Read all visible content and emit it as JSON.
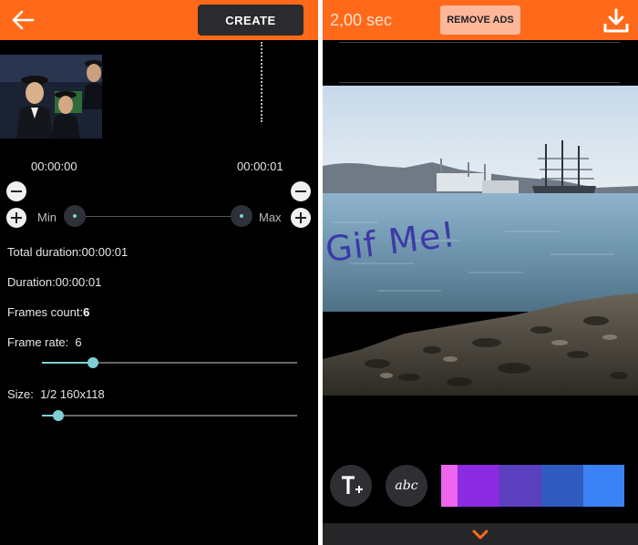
{
  "left_screen": {
    "topbar": {
      "create_label": "CREATE",
      "back_icon": "arrow-left-icon"
    },
    "timeline": {
      "start_time": "00:00:00",
      "end_time": "00:00:01"
    },
    "range": {
      "min_label": "Min",
      "max_label": "Max"
    },
    "info": {
      "total_duration": "Total duration:00:00:01",
      "duration": "Duration:00:00:01",
      "frames_label": "Frames count:",
      "frames_value": "6",
      "frame_rate_label": "Frame rate:",
      "frame_rate_value": "6",
      "size_label": "Size:",
      "size_value": "1/2 160x118"
    },
    "sliders": {
      "frame_rate_fraction": 0.2,
      "size_fraction": 0.065
    }
  },
  "right_screen": {
    "topbar": {
      "duration": "2,00 sec",
      "remove_ads_label": "REMOVE ADS",
      "download_icon": "download-icon"
    },
    "overlay_text": "Gif Me!",
    "tools": {
      "text_icon": "text-add-icon",
      "font_icon": "font-style-icon",
      "font_glyph": "abc"
    },
    "palette": [
      "#ee66ee",
      "#8b2be2",
      "#5a3fbe",
      "#2f5ac0",
      "#3b82f6"
    ],
    "expand_icon": "chevron-down-icon"
  },
  "colors": {
    "accent": "#ff6a1a",
    "slider": "#7fd0d6",
    "background": "#000000"
  }
}
